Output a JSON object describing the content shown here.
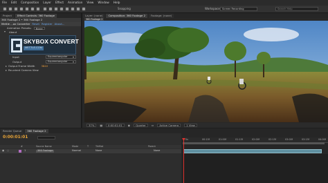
{
  "menubar": [
    "File",
    "Edit",
    "Composition",
    "Layer",
    "Effect",
    "Animation",
    "View",
    "Window",
    "Help"
  ],
  "toolbar": {
    "snapping": "Snapping",
    "workspace_label": "Workspace",
    "workspace_value": "Screen Recording",
    "search_placeholder": "Search Help"
  },
  "left_panel": {
    "tabs": [
      "Project",
      "Effect Controls: 360 Footage"
    ],
    "breadcrumb": "360 Footage 2 • 360 Footage 2",
    "effect_name": "Mettle ...ox Converter",
    "reset": "Reset",
    "register": "Register",
    "about_link": "About...",
    "animation_presets_label": "Animation Presets:",
    "animation_presets_value": "None",
    "about": "About",
    "logo_title": "SKYBOX CONVERT",
    "logo_sub": "METTLE.COM",
    "input_label": "Input",
    "input_value": "Equirectangular",
    "output_label": "Output",
    "output_value": "Equirectangular",
    "frame_width_label": "Output Frame Width",
    "frame_width_value": "3840",
    "recenter_label": "Re-orient Camera View"
  },
  "comp_panel": {
    "tabs": [
      "Composition: 360 Footage 2",
      "Footage: (none)"
    ],
    "layer_tab": "Layer: (none)",
    "active_tab": "360 Footage 2",
    "zoom": "37%",
    "timecode": "0:00:01:01",
    "resolution": "Quarter",
    "camera": "Active Camera",
    "view": "1 View"
  },
  "timeline": {
    "tabs": [
      "Render Queue",
      "360 Footage 2"
    ],
    "timecode": "0:00:01:01",
    "columns": [
      "#",
      "Source Name",
      "Mode",
      "T",
      "TrkMat",
      "Parent"
    ],
    "layer_index": "1",
    "layer_name": "360 Footage",
    "layer_mode": "Normal",
    "layer_trkmat": "None",
    "layer_parent": "None",
    "ruler_labels": [
      "0s",
      "00:15f",
      "01:00f",
      "01:15f",
      "02:00f",
      "02:15f",
      "03:00f",
      "03:15f",
      "04:00f"
    ]
  }
}
